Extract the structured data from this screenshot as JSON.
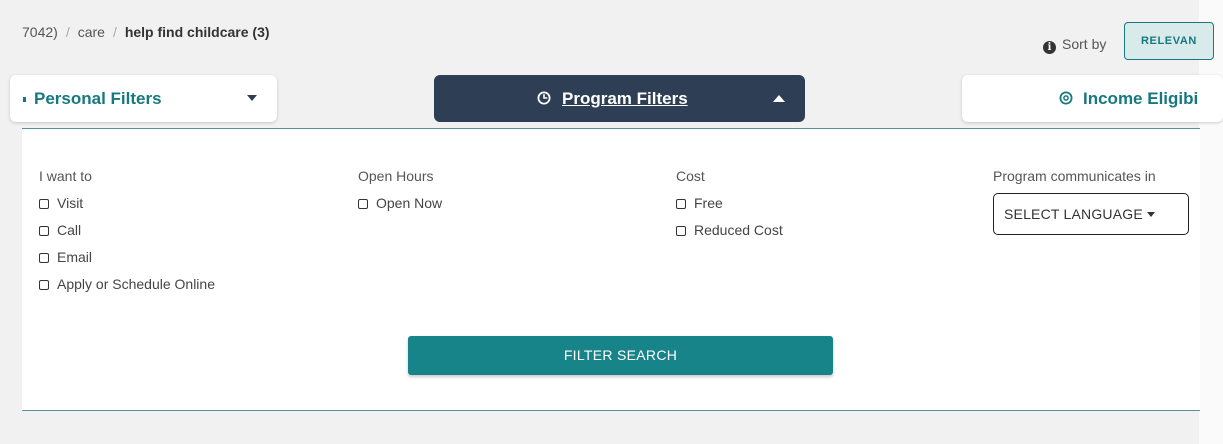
{
  "breadcrumb": {
    "items": [
      "7042)",
      "care"
    ],
    "current": "help find childcare (3)"
  },
  "sort": {
    "label": "Sort by",
    "value": "RELEVAN"
  },
  "tabs": {
    "personal": {
      "label": "Personal Filters"
    },
    "program": {
      "label": "Program Filters"
    },
    "income": {
      "label": "Income Eligibi"
    }
  },
  "filters": {
    "i_want_to": {
      "title": "I want to",
      "options": [
        "Visit",
        "Call",
        "Email",
        "Apply or Schedule Online"
      ]
    },
    "open_hours": {
      "title": "Open Hours",
      "options": [
        "Open Now"
      ]
    },
    "cost": {
      "title": "Cost",
      "options": [
        "Free",
        "Reduced Cost"
      ]
    },
    "language": {
      "title": "Program communicates in",
      "button": "SELECT LANGUAGE"
    }
  },
  "filter_search": {
    "label": "FILTER SEARCH"
  },
  "colors": {
    "teal": "#17787f",
    "navy": "#2e3f55",
    "button": "#17848a"
  }
}
